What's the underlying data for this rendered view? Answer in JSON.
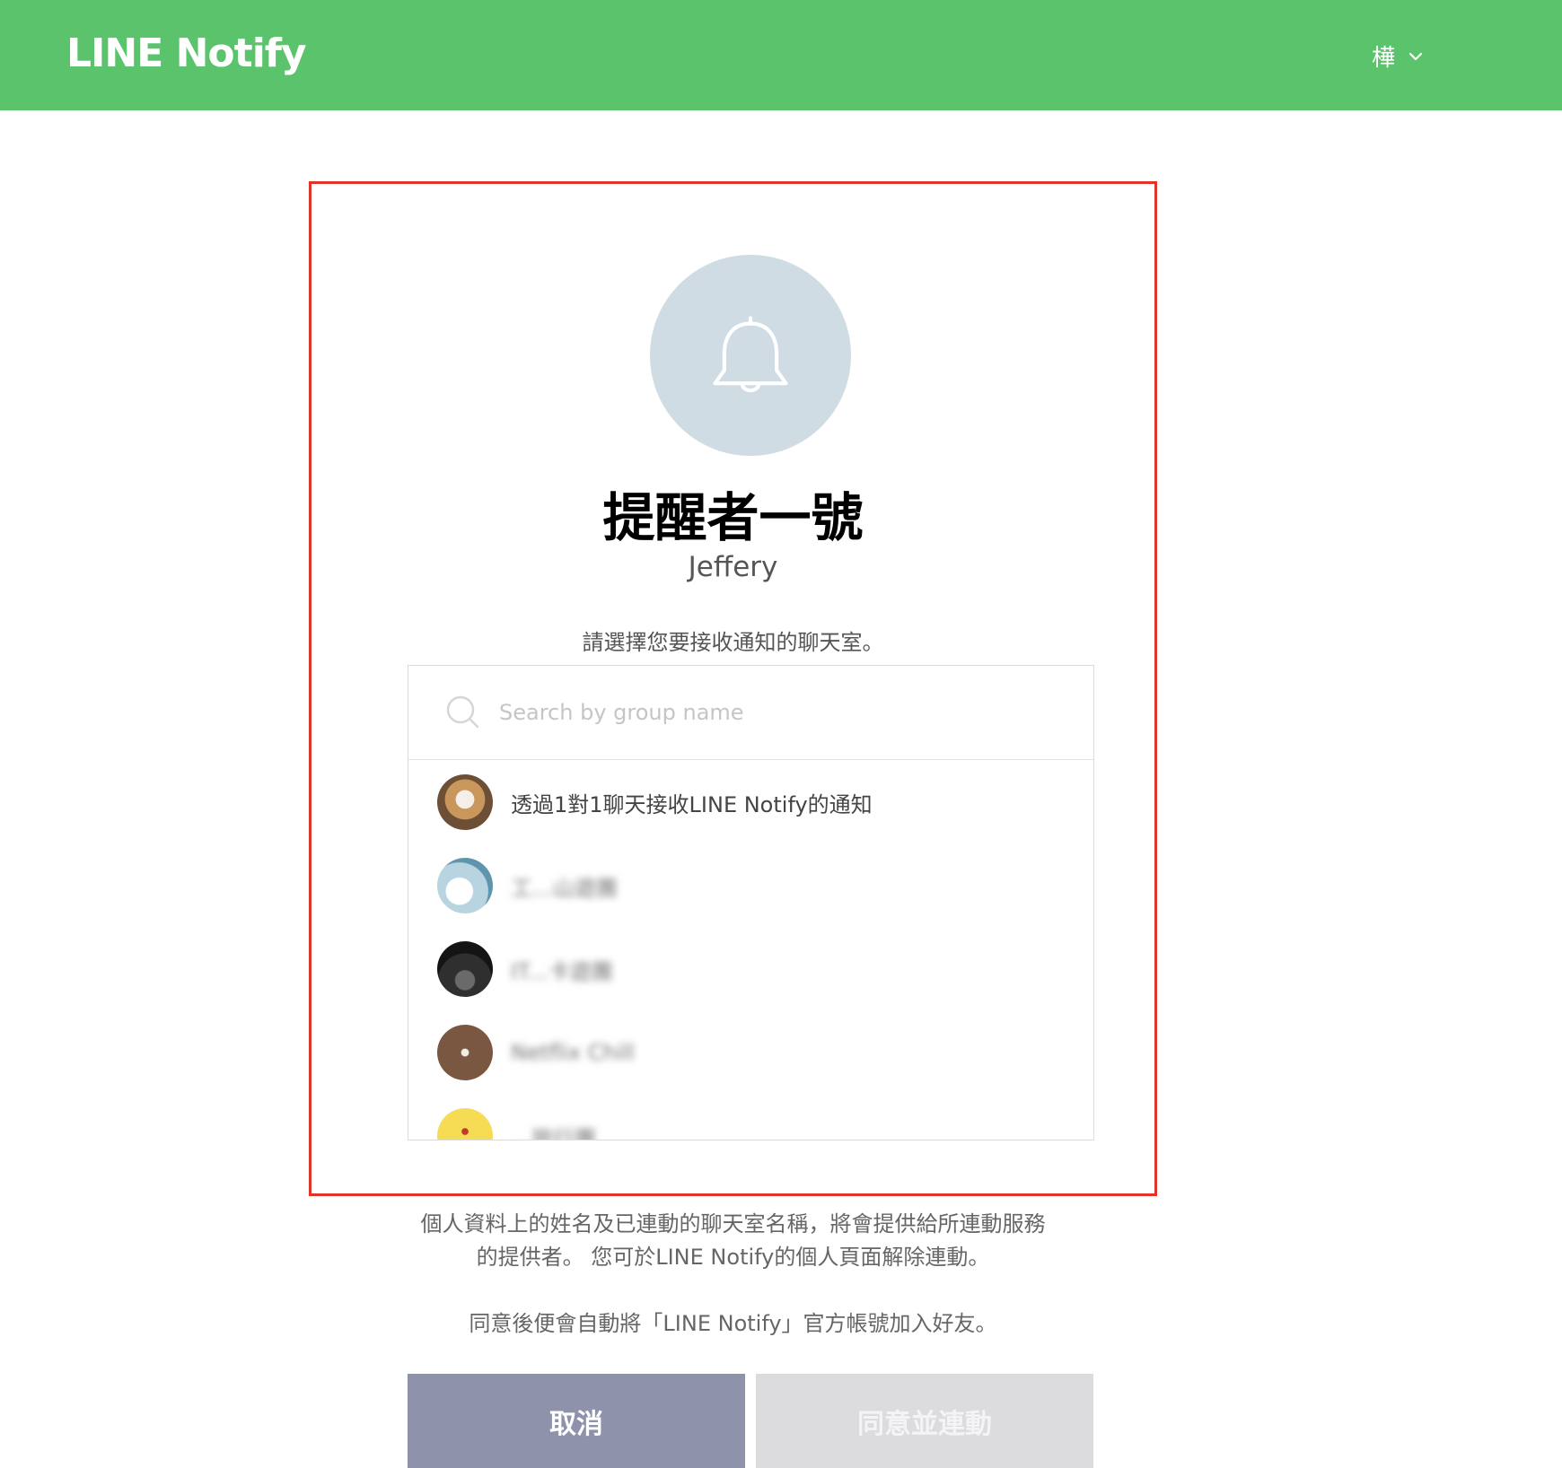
{
  "header": {
    "logo": "LINE Notify",
    "user_name": "樺"
  },
  "service": {
    "name": "提醒者一號",
    "owner": "Jeffery"
  },
  "prompt": "請選擇您要接收通知的聊天室。",
  "search": {
    "placeholder": "Search by group name"
  },
  "chats": [
    {
      "label": "透過1對1聊天接收LINE Notify的通知"
    },
    {
      "label": "工...山遊團"
    },
    {
      "label": "IT...卡遊團"
    },
    {
      "label": "Netflix Chill"
    },
    {
      "label": "...旅行團"
    }
  ],
  "disclaimer": {
    "line1": "個人資料上的姓名及已連動的聊天室名稱，將會提供給所連動服務",
    "line2": "的提供者。 您可於LINE Notify的個人頁面解除連動。"
  },
  "note": "同意後便會自動將「LINE Notify」官方帳號加入好友。",
  "buttons": {
    "cancel": "取消",
    "agree": "同意並連動"
  },
  "colors": {
    "header": "#5bc36b",
    "highlight_frame": "#e0342b",
    "cancel_button": "#8e93ab",
    "agree_button_disabled": "#dcdcdf",
    "bell_circle": "#cfdce3"
  }
}
